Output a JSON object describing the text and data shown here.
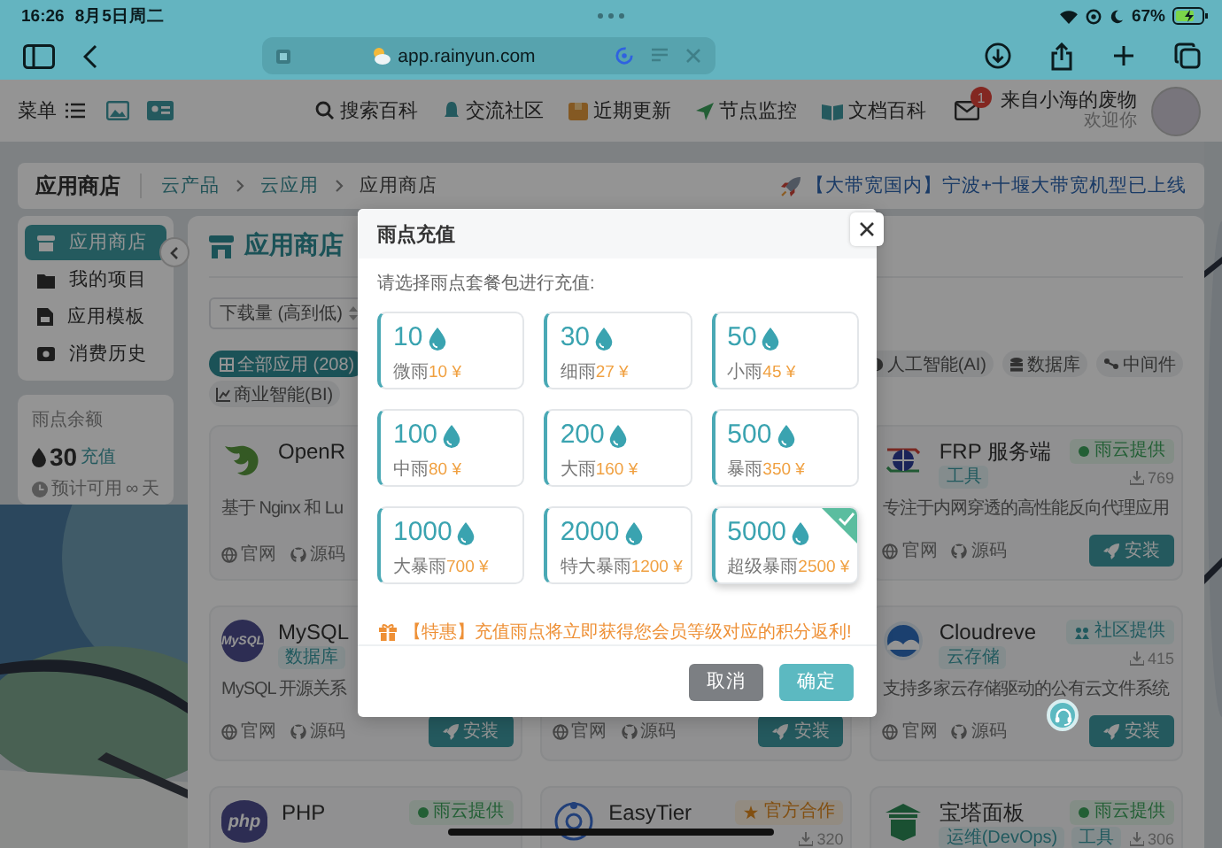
{
  "status_bar": {
    "time": "16:26",
    "date": "8月5日周二",
    "battery": "67%"
  },
  "browser": {
    "url": "app.rainyun.com"
  },
  "nav": {
    "menu": "菜单",
    "links": [
      "搜索百科",
      "交流社区",
      "近期更新",
      "节点监控",
      "文档百科"
    ],
    "mail_badge": "1",
    "user_name": "来自小海的废物",
    "greeting": "欢迎你"
  },
  "breadcrumb": {
    "title": "应用商店",
    "path": [
      {
        "label": "云产品",
        "link": true
      },
      {
        "label": "云应用",
        "link": true
      },
      {
        "label": "应用商店",
        "link": false
      }
    ]
  },
  "announcement": "【大带宽国内】宁波+十堰大带宽机型已上线",
  "sidebar": {
    "items": [
      {
        "label": "应用商店",
        "selected": true
      },
      {
        "label": "我的项目",
        "selected": false
      },
      {
        "label": "应用模板",
        "selected": false
      },
      {
        "label": "消费历史",
        "selected": false
      }
    ]
  },
  "balance": {
    "label": "雨点余额",
    "amount": "30",
    "recharge": "充值",
    "estimate_label": "预计可用",
    "estimate_value": "∞",
    "estimate_unit": "天"
  },
  "store": {
    "title": "应用商店",
    "sort": "下载量 (高到低)",
    "filter_rows": [
      [
        {
          "label": "全部应用 (208)",
          "selected": true
        },
        {
          "label": "人工智能(AI)",
          "selected": false
        },
        {
          "label": "数据库",
          "selected": false
        },
        {
          "label": "中间件",
          "selected": false
        }
      ],
      [
        {
          "label": "商业智能(BI)",
          "selected": false
        }
      ]
    ],
    "apps": [
      {
        "name": "OpenR",
        "description": "基于 Nginx 和 Lu",
        "links": [
          "官网",
          "源码"
        ]
      },
      {
        "name": "FRP 服务端",
        "badge": {
          "text": "雨云提供",
          "kind": "cloud"
        },
        "tags": [
          "工具"
        ],
        "downloads": "769",
        "description": "专注于内网穿透的高性能反向代理应用",
        "links": [
          "官网",
          "源码"
        ],
        "install": "安装"
      },
      {
        "name": "MySQL",
        "logo_text": "MySQL",
        "tags": [
          "数据库"
        ],
        "description": "MySQL 开源关系",
        "links": [
          "官网",
          "源码"
        ],
        "install": "安装"
      },
      {
        "links": [
          "官网",
          "源码"
        ],
        "install": "安装"
      },
      {
        "name": "Cloudreve",
        "badge": {
          "text": "社区提供",
          "kind": "community"
        },
        "tags": [
          "云存储"
        ],
        "downloads": "415",
        "description": "支持多家云存储驱动的公有云文件系统",
        "links": [
          "官网",
          "源码"
        ],
        "install": "安装"
      },
      {
        "name": "PHP",
        "logo_text": "php",
        "badge": {
          "text": "雨云提供",
          "kind": "cloud"
        }
      },
      {
        "name": "EasyTier",
        "badge": {
          "text": "官方合作",
          "kind": "official"
        },
        "downloads": "320"
      },
      {
        "name": "宝塔面板",
        "badge": {
          "text": "雨云提供",
          "kind": "cloud"
        },
        "tags": [
          "运维(DevOps)",
          "工具"
        ],
        "downloads": "306"
      }
    ]
  },
  "modal": {
    "title": "雨点充值",
    "prompt": "请选择雨点套餐包进行充值:",
    "packages": [
      {
        "amount": "10",
        "name": "微雨",
        "price": "10 ¥",
        "selected": false
      },
      {
        "amount": "30",
        "name": "细雨",
        "price": "27 ¥",
        "selected": false
      },
      {
        "amount": "50",
        "name": "小雨",
        "price": "45 ¥",
        "selected": false
      },
      {
        "amount": "100",
        "name": "中雨",
        "price": "80 ¥",
        "selected": false
      },
      {
        "amount": "200",
        "name": "大雨",
        "price": "160 ¥",
        "selected": false
      },
      {
        "amount": "500",
        "name": "暴雨",
        "price": "350 ¥",
        "selected": false
      },
      {
        "amount": "1000",
        "name": "大暴雨",
        "price": "700 ¥",
        "selected": false
      },
      {
        "amount": "2000",
        "name": "特大暴雨",
        "price": "1200 ¥",
        "selected": false
      },
      {
        "amount": "5000",
        "name": "超级暴雨",
        "price": "2500 ¥",
        "selected": true
      }
    ],
    "tip": "【特惠】充值雨点将立即获得您会员等级对应的积分返利!",
    "buttons": [
      {
        "label": "取消",
        "kind": "secondary"
      },
      {
        "label": "确定",
        "kind": "primary"
      }
    ]
  }
}
